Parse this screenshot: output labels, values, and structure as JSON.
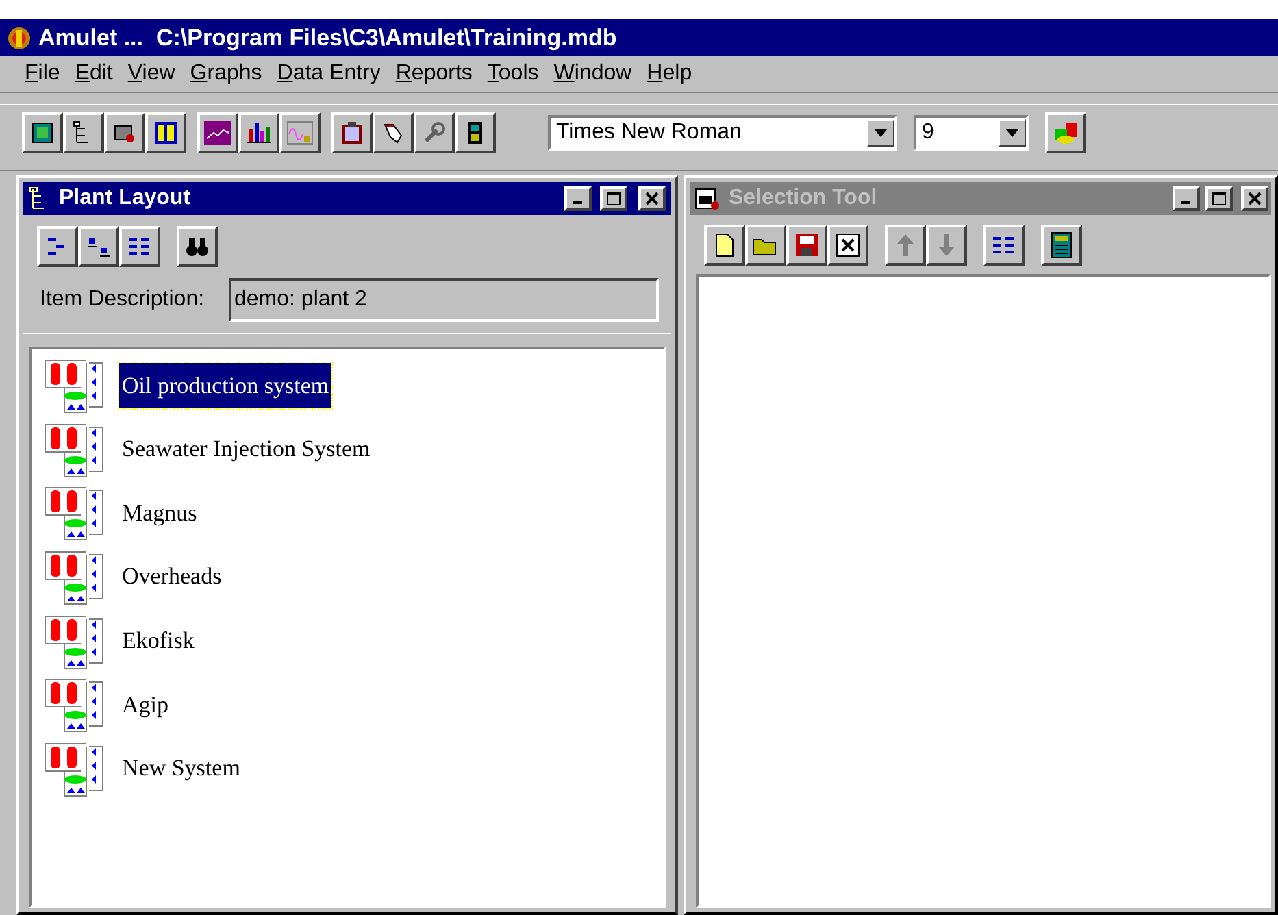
{
  "window": {
    "title": "Amulet ...  C:\\Program Files\\C3\\Amulet\\Training.mdb"
  },
  "menu": [
    {
      "label": "File"
    },
    {
      "label": "Edit"
    },
    {
      "label": "View"
    },
    {
      "label": "Graphs"
    },
    {
      "label": "Data Entry"
    },
    {
      "label": "Reports"
    },
    {
      "label": "Tools"
    },
    {
      "label": "Window"
    },
    {
      "label": "Help"
    }
  ],
  "toolbar": {
    "font_field": {
      "value": "Times New Roman"
    },
    "size_field": {
      "value": "9"
    }
  },
  "plant_layout": {
    "title": "Plant Layout",
    "active": true,
    "item_description": {
      "label": "Item Description:",
      "value": "demo: plant 2"
    },
    "items": [
      {
        "label": "Oil production system",
        "selected": true
      },
      {
        "label": "Seawater Injection System",
        "selected": false
      },
      {
        "label": "Magnus",
        "selected": false
      },
      {
        "label": "Overheads",
        "selected": false
      },
      {
        "label": "Ekofisk",
        "selected": false
      },
      {
        "label": "Agip",
        "selected": false
      },
      {
        "label": "New System",
        "selected": false
      }
    ]
  },
  "selection_tool": {
    "title": "Selection Tool",
    "active": false,
    "move_up_disabled": true,
    "move_down_disabled": true
  }
}
